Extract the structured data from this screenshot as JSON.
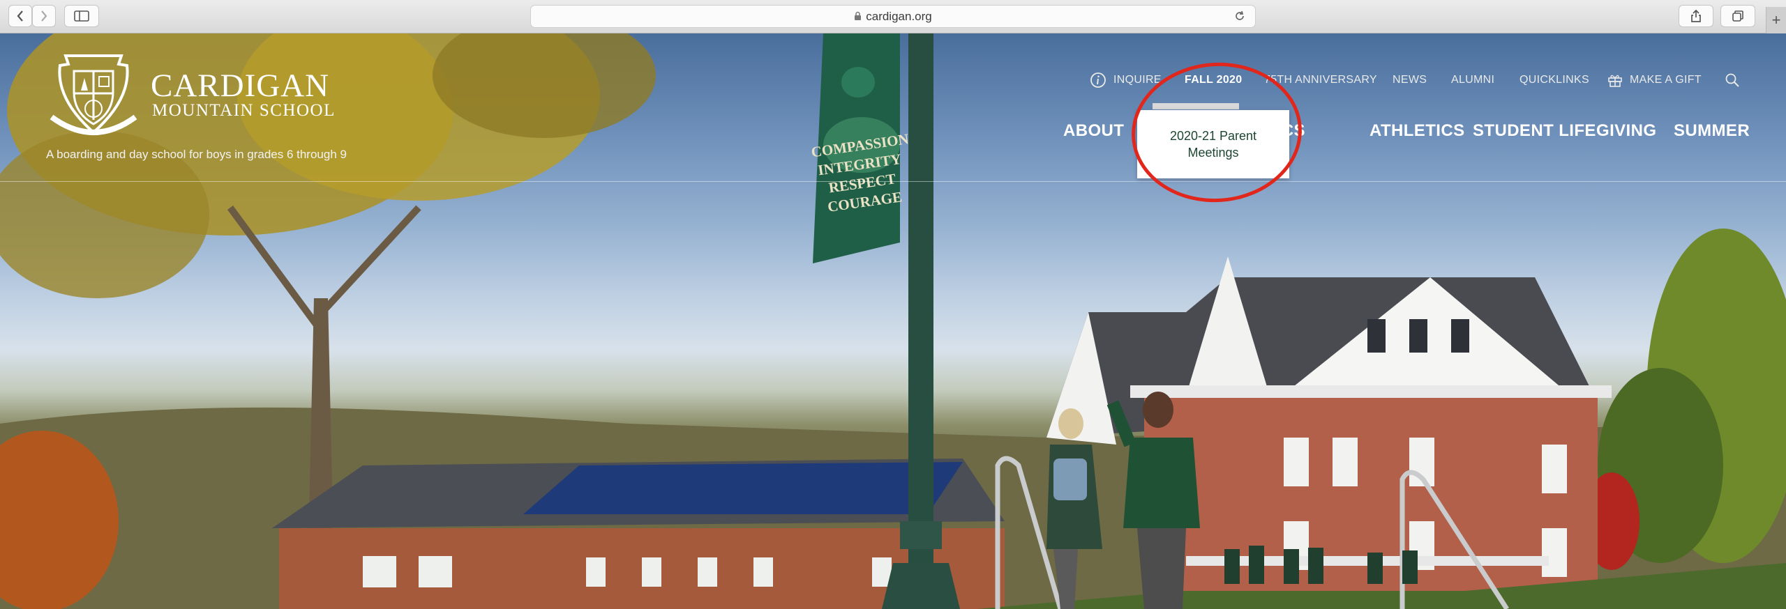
{
  "browser": {
    "url": "cardigan.org"
  },
  "site": {
    "name_line1": "CARDIGAN",
    "name_line2": "MOUNTAIN SCHOOL",
    "tagline": "A boarding and day school for boys in grades 6 through 9"
  },
  "utility_nav": [
    {
      "label": "INQUIRE",
      "icon": "info-icon"
    },
    {
      "label": "FALL 2020",
      "active": true
    },
    {
      "label": "75TH ANNIVERSARY"
    },
    {
      "label": "NEWS"
    },
    {
      "label": "ALUMNI"
    },
    {
      "label": "QUICKLINKS"
    },
    {
      "label": "MAKE A GIFT",
      "icon": "gift-icon"
    }
  ],
  "main_nav": [
    {
      "label": "ABOUT"
    },
    {
      "label": "ACADEMICS"
    },
    {
      "label": "ATHLETICS"
    },
    {
      "label": "STUDENT LIFE"
    },
    {
      "label": "GIVING"
    },
    {
      "label": "SUMMER"
    }
  ],
  "dropdown": {
    "item": "2020-21 Parent Meetings"
  },
  "banner": {
    "words": "COMPASSION INTEGRITY RESPECT COURAGE"
  },
  "colors": {
    "brand_green": "#1d4632",
    "annotation_red": "#e1261c"
  }
}
